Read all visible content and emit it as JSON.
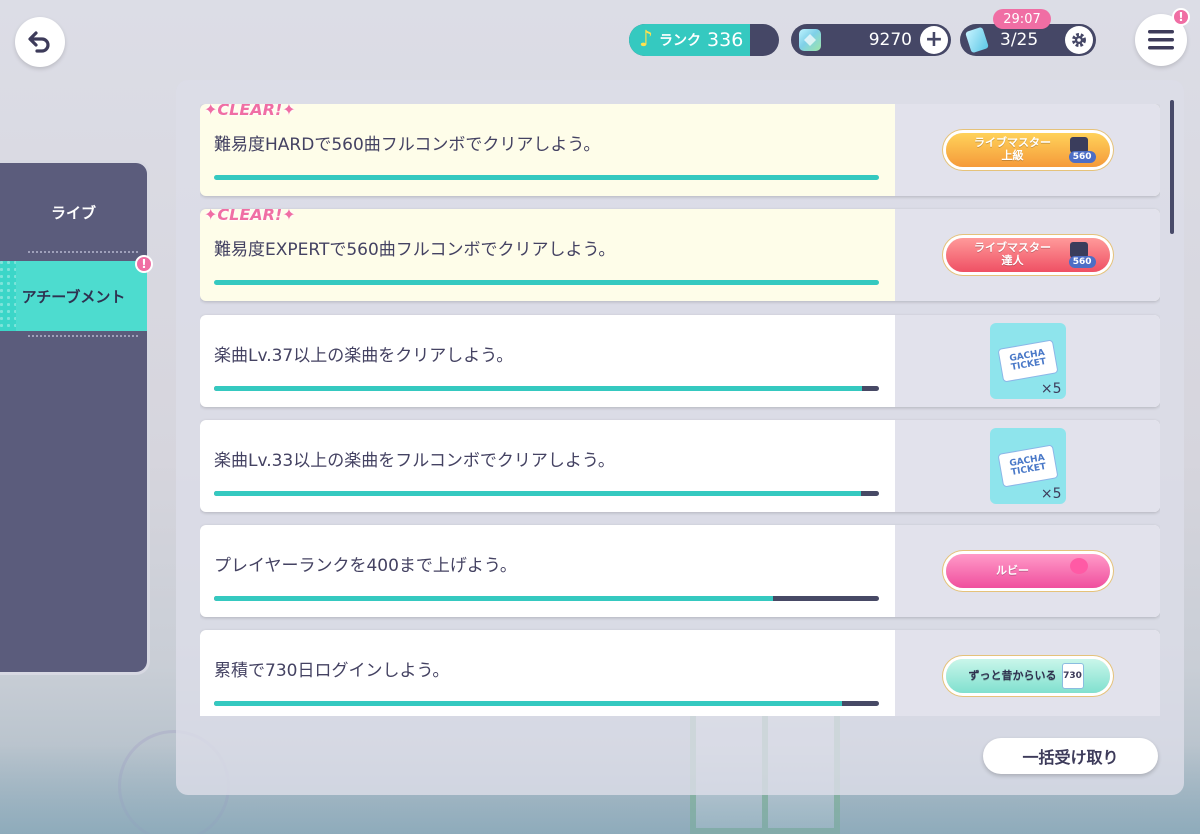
{
  "header": {
    "rank_label": "ランク",
    "rank_value": "336",
    "gems": "9270",
    "tickets": "3/25",
    "timer": "29:07",
    "alert_mark": "!"
  },
  "sidebar": {
    "items": [
      {
        "label": "ライブ",
        "active": false
      },
      {
        "label": "アチーブメント",
        "active": true
      }
    ],
    "alert_mark": "!"
  },
  "clear_label": "CLEAR!",
  "missions": [
    {
      "text": "難易度HARDで560曲フルコンボでクリアしよう。",
      "progress": 1.0,
      "cleared": true,
      "reward": {
        "type": "badge",
        "style": "orange",
        "label": "ライブマスター",
        "sub_label": "上級",
        "tag": "560"
      }
    },
    {
      "text": "難易度EXPERTで560曲フルコンボでクリアしよう。",
      "progress": 1.0,
      "cleared": true,
      "reward": {
        "type": "badge",
        "style": "red",
        "label": "ライブマスター",
        "sub_label": "達人",
        "tag": "560"
      }
    },
    {
      "text": "楽曲Lv.37以上の楽曲をクリアしよう。",
      "progress": 0.975,
      "cleared": false,
      "reward": {
        "type": "ticket",
        "line1": "GACHA",
        "line2": "TICKET",
        "quantity": "×5"
      }
    },
    {
      "text": "楽曲Lv.33以上の楽曲をフルコンボでクリアしよう。",
      "progress": 0.973,
      "cleared": false,
      "reward": {
        "type": "ticket",
        "line1": "GACHA",
        "line2": "TICKET",
        "quantity": "×5"
      }
    },
    {
      "text": "プレイヤーランクを400まで上げよう。",
      "progress": 0.84,
      "cleared": false,
      "reward": {
        "type": "badge",
        "style": "pink",
        "label": "ルビー"
      }
    },
    {
      "text": "累積で730日ログインしよう。",
      "progress": 0.945,
      "cleared": false,
      "reward": {
        "type": "badge",
        "style": "mint",
        "label": "ずっと昔からいる",
        "tag": "730"
      }
    }
  ],
  "receive_all_label": "一括受け取り",
  "colors": {
    "accent": "#35c9c0",
    "pink": "#f06ea4",
    "dark": "#454766"
  }
}
